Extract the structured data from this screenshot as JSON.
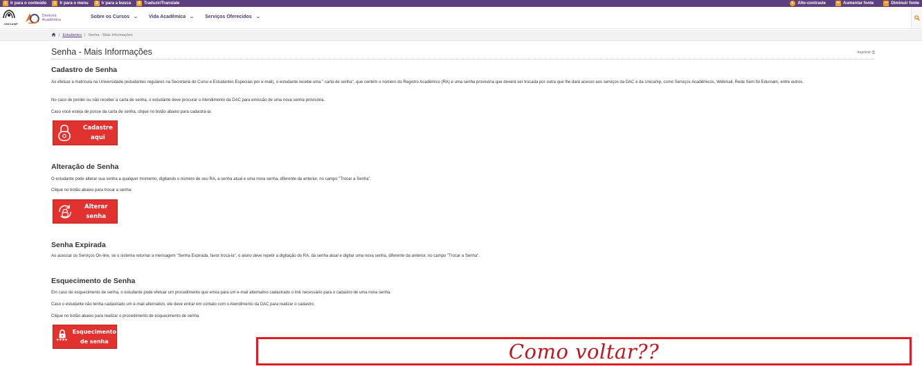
{
  "topbar": {
    "skip_links": [
      {
        "num": "1",
        "label": "Ir para o conteúdo"
      },
      {
        "num": "2",
        "label": "Ir para o menu"
      },
      {
        "num": "3",
        "label": "Ir para a busca"
      },
      {
        "num": "4",
        "label": "Traduzir/Translate"
      }
    ],
    "accessibility": [
      {
        "icon": "contrast-icon",
        "glyph": "◐",
        "label": "Alto-contraste"
      },
      {
        "icon": "plus-icon",
        "glyph": "+",
        "label": "Aumentar fonte"
      },
      {
        "icon": "minus-icon",
        "glyph": "−",
        "label": "Diminuir fonte"
      }
    ]
  },
  "header": {
    "unicamp_label": "UNICAMP",
    "dac_label_1": "Diretoria",
    "dac_label_2": "Acadêmica",
    "nav": [
      {
        "label": "Sobre os Cursos"
      },
      {
        "label": "Vida Acadêmica"
      },
      {
        "label": "Serviços Oferecidos"
      }
    ]
  },
  "breadcrumb": {
    "sep": "|",
    "parent": "Estudantes",
    "current": "Senha - Mais Informações"
  },
  "page": {
    "title": "Senha - Mais Informações",
    "print_label": "Imprimir"
  },
  "sections": {
    "cadastro": {
      "title": "Cadastro de Senha",
      "p1": "Ao efetuar a matrícula na Universidade (estudantes regulares na Secretaria do Curso e Estudantes Especiais por e-mail), o estudante recebe uma \" carta de senha\", que contém o número do Registro Acadêmico (RA) e uma senha provisória que deverá ser trocada por outra que lhe dará acesso aos serviços da DAC e da Unicamp, como Serviços Acadêmicos, Webmail, Rede Sem fio Eduroam, entre outros.",
      "p2": "No caso de perder ou não receber a carta de senha, o estudante deve procurar o Atendimento da DAC para emissão de uma nova senha provisória.",
      "p3": "Caso você esteja de posse da carta de senha, clique no botão abaixo para cadastrá-la:",
      "button_line1": "Cadastre",
      "button_line2": "aqui"
    },
    "alteracao": {
      "title": "Alteração de Senha",
      "p1": "O estudante pode alterar sua senha a qualquer momento, digitando o número de seu RA, a senha atual e uma nova senha, diferente da anterior, no campo \"Trocar a Senha\".",
      "p2": "Clique no botão abaixo para trocar a senha:",
      "button_line1": "Alterar",
      "button_line2": "senha"
    },
    "expirada": {
      "title": "Senha Expirada",
      "p1": "Ao acessar os Serviços On-line, se o sistema retornar a mensagem \"Senha Expirada, favor trocá-la\", o aluno deve repetir a digitação do RA, da senha atual e digitar uma nova senha, diferente da anterior, no campo \"Trocar a Senha\"."
    },
    "esquecimento": {
      "title": "Esquecimento de Senha",
      "p1": "Em caso de esquecimento de senha, o estudante pode efetuar um procedimento que envia para um e-mail alternativo cadastrado o link necessário para o cadastro de uma nova senha.",
      "p2": " Caso o estudante não tenha cadastrado um e-mail alternativo, ele deve entrar em contato com o Atendimento da DAC para realizar o cadastro.",
      "p3": " Clique no botão abaixo para realizar o procedimento de esquecimento de senha:",
      "button_line1": "Esquecimento",
      "button_line2": "de senha",
      "button_stars": "****"
    }
  },
  "annotation": {
    "text": "Como voltar??"
  },
  "colors": {
    "topbar": "#5b3f7f",
    "accent_orange": "#f0a029",
    "button_red": "#e23230",
    "annotation_red": "#e21b23"
  }
}
